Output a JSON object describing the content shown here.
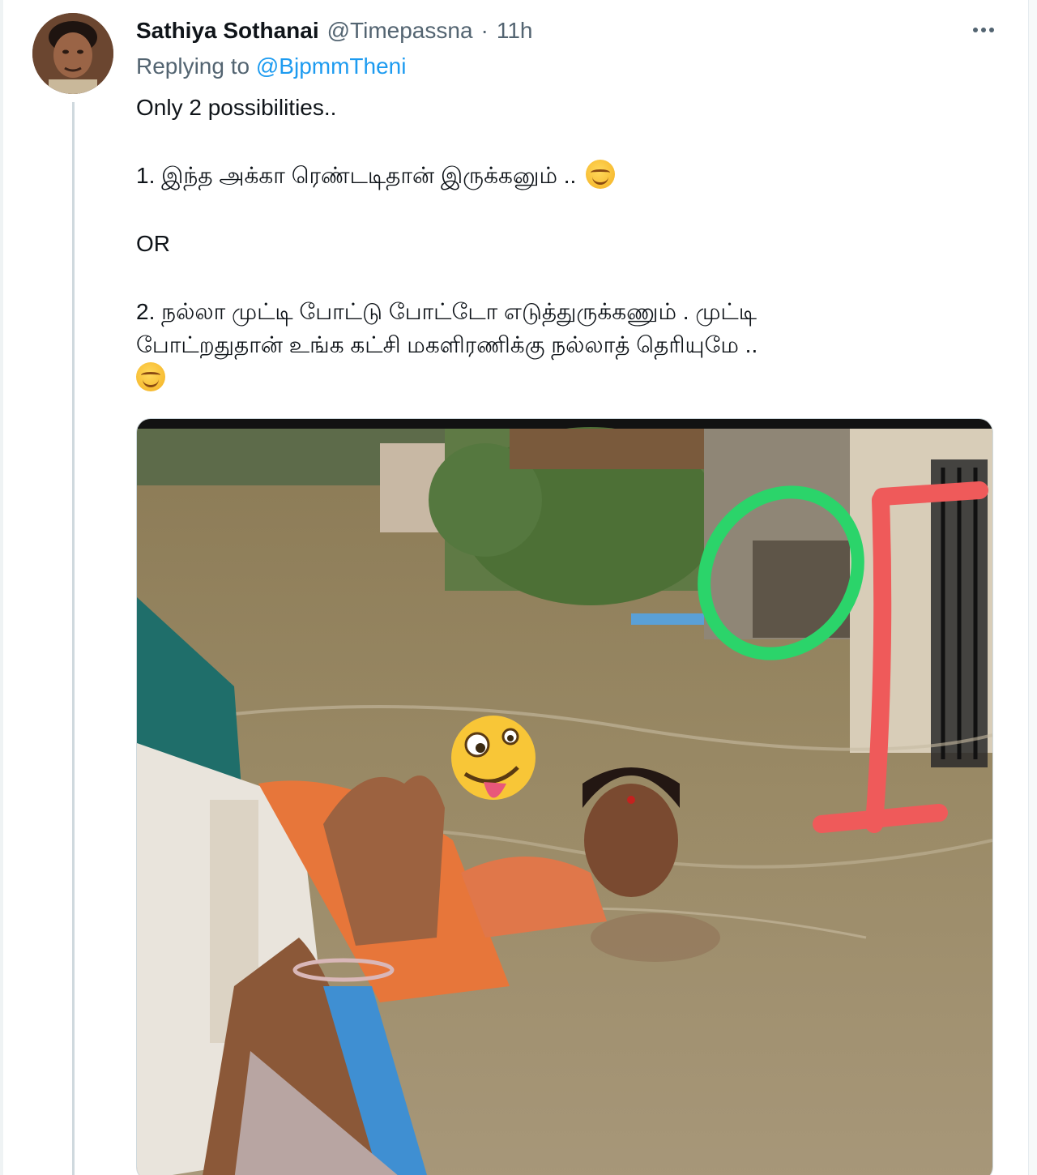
{
  "tweet": {
    "author": {
      "display_name": "Sathiya Sothanai",
      "handle": "@Timepassna"
    },
    "separator": "·",
    "time": "11h",
    "replying_to": {
      "label": "Replying to",
      "mention": "@BjpmmTheni"
    },
    "text": {
      "line1": "Only 2 possibilities..",
      "line2": "1. இந்த அக்கா ரெண்டடிதான் இருக்கனும் ..",
      "line3": "OR",
      "line4a": "2. நல்லா முட்டி போட்டு போட்டோ எடுத்துருக்கணும் . முட்டி",
      "line4b": "போட்றதுதான் உங்க கட்சி மகளிரணிக்கு நல்லாத் தெரியுமே .."
    },
    "emojis": [
      "smiling-face-emoji",
      "smirking-face-emoji",
      "zany-face-emoji"
    ],
    "media": {
      "kind": "photo",
      "subject": "flooded street photo with annotations"
    }
  },
  "colors": {
    "text": "#0f1419",
    "secondary": "#536471",
    "link": "#1d9bf0",
    "annotation_green": "#2bd46a",
    "annotation_red": "#ef5a5a"
  }
}
